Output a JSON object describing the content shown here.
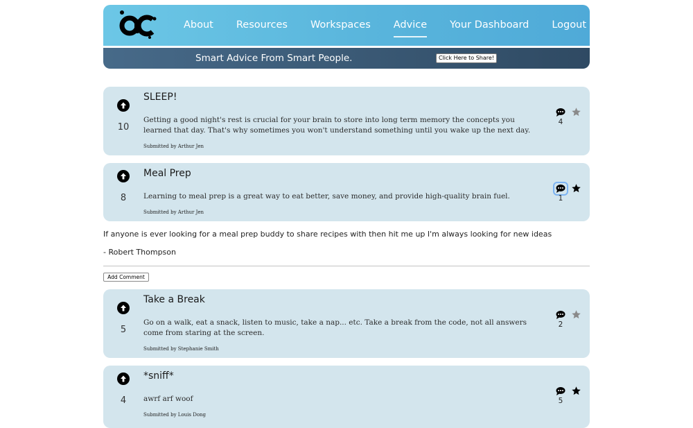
{
  "nav": {
    "logo_alt": "AC",
    "items": [
      {
        "label": "About"
      },
      {
        "label": "Resources"
      },
      {
        "label": "Workspaces"
      },
      {
        "label": "Advice",
        "active": true
      },
      {
        "label": "Your Dashboard"
      },
      {
        "label": "Logout"
      }
    ]
  },
  "banner": {
    "tagline": "Smart Advice From Smart People.",
    "share_label": "Click Here to Share!"
  },
  "posts": [
    {
      "title": "SLEEP!",
      "votes": "10",
      "body": "Getting a good night's rest is crucial for your brain to store into long term memory the concepts you learned that day. That's why sometimes you won't understand something until you wake up the next day.",
      "author": "Submitted by Arthur Jen",
      "comment_count": "4",
      "starred": false
    },
    {
      "title": "Meal Prep",
      "votes": "8",
      "body": "Learning to meal prep is a great way to eat better, save money, and provide high-quality brain fuel.",
      "author": "Submitted by Arthur Jen",
      "comment_count": "1",
      "starred": true
    },
    {
      "title": "Take a Break",
      "votes": "5",
      "body": "Go on a walk, eat a snack, listen to music, take a nap... etc. Take a break from the code, not all answers come from staring at the screen.",
      "author": "Submitted by Stephanie Smith",
      "comment_count": "2",
      "starred": false
    },
    {
      "title": "*sniff*",
      "votes": "4",
      "body": "awrf arf woof",
      "author": "Submitted by Louis Dong",
      "comment_count": "5",
      "starred": true
    }
  ],
  "comments": {
    "text": "If anyone is ever looking for a meal prep buddy to share recipes with then hit me up I'm always looking for new ideas",
    "author": "- Robert Thompson",
    "add_label": "Add Comment"
  },
  "colors": {
    "header_gradient_start": "#6cc7e6",
    "header_gradient_end": "#4faad8",
    "banner": "#2f4a63",
    "card_background": "#d3e5ed",
    "star_active": "#000000",
    "star_inactive": "#8a8a8a"
  }
}
